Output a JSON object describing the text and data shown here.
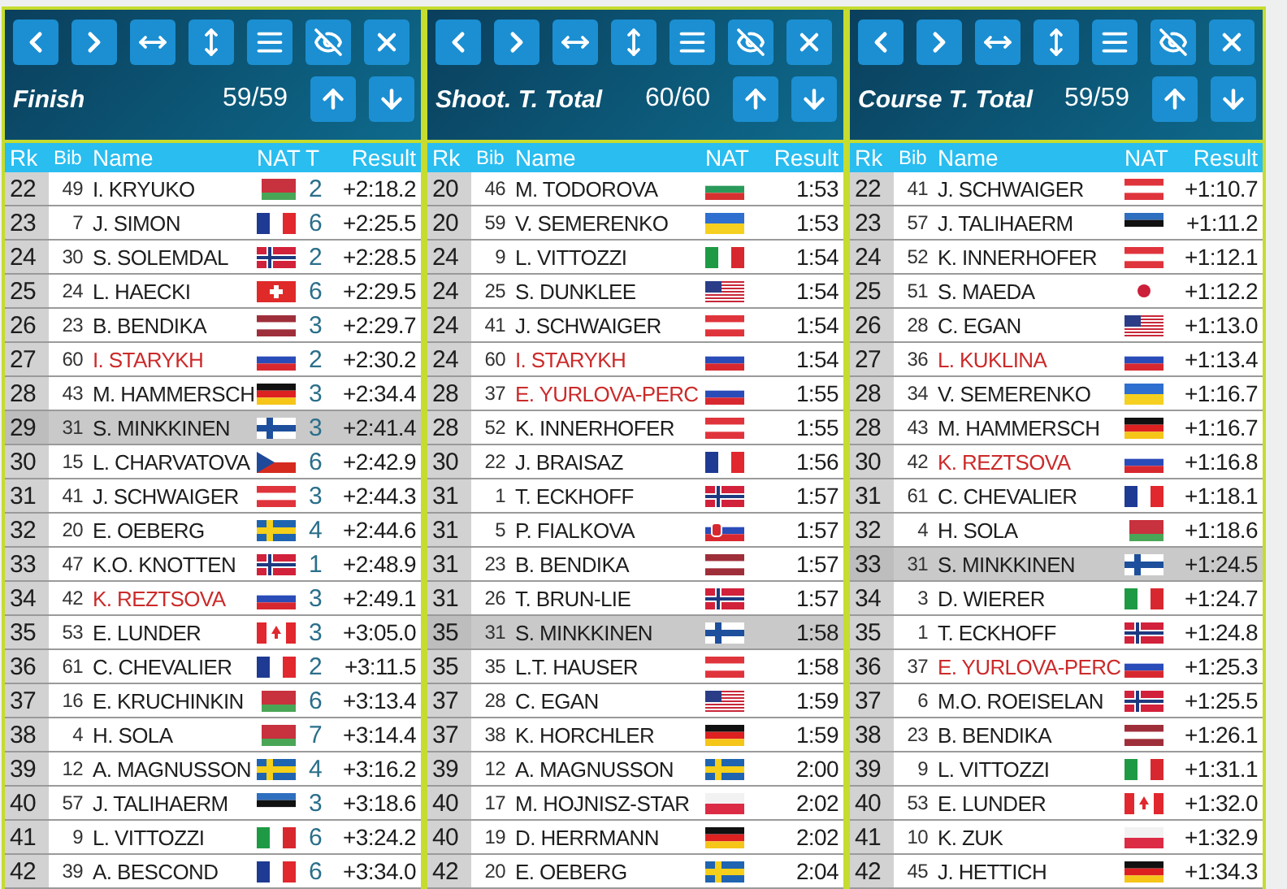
{
  "panels": [
    {
      "title": "Finish",
      "count": "59/59",
      "columns": [
        {
          "kind": "rank",
          "label": "Rk"
        },
        {
          "kind": "bib",
          "label": "Bib"
        },
        {
          "kind": "name",
          "label": "Name"
        },
        {
          "kind": "flag",
          "label": "NAT"
        },
        {
          "kind": "penalty",
          "label": "T"
        },
        {
          "kind": "result",
          "label": "Result"
        }
      ],
      "rows": [
        {
          "rank": "22",
          "bib": "49",
          "name": "I. KRYUKO",
          "flag": {
            "kind": "belarus"
          },
          "t": "2",
          "result": "+2:18.2",
          "flagged": false,
          "selected": false
        },
        {
          "rank": "23",
          "bib": "7",
          "name": "J. SIMON",
          "flag": {
            "kind": "france"
          },
          "t": "6",
          "result": "+2:25.5",
          "flagged": false,
          "selected": false
        },
        {
          "rank": "24",
          "bib": "30",
          "name": "S. SOLEMDAL",
          "flag": {
            "kind": "norway"
          },
          "t": "2",
          "result": "+2:28.5",
          "flagged": false,
          "selected": false
        },
        {
          "rank": "25",
          "bib": "24",
          "name": "L. HAECKI",
          "flag": {
            "kind": "switzerland"
          },
          "t": "6",
          "result": "+2:29.5",
          "flagged": false,
          "selected": false
        },
        {
          "rank": "26",
          "bib": "23",
          "name": "B. BENDIKA",
          "flag": {
            "kind": "latvia"
          },
          "t": "3",
          "result": "+2:29.7",
          "flagged": false,
          "selected": false
        },
        {
          "rank": "27",
          "bib": "60",
          "name": "I. STARYKH",
          "flag": {
            "kind": "russia"
          },
          "t": "2",
          "result": "+2:30.2",
          "flagged": true,
          "selected": false
        },
        {
          "rank": "28",
          "bib": "43",
          "name": "M. HAMMERSCH",
          "flag": {
            "kind": "germany"
          },
          "t": "3",
          "result": "+2:34.4",
          "flagged": false,
          "selected": false
        },
        {
          "rank": "29",
          "bib": "31",
          "name": "S. MINKKINEN",
          "flag": {
            "kind": "finland"
          },
          "t": "3",
          "result": "+2:41.4",
          "flagged": false,
          "selected": true
        },
        {
          "rank": "30",
          "bib": "15",
          "name": "L. CHARVATOVA",
          "flag": {
            "kind": "czechia"
          },
          "t": "6",
          "result": "+2:42.9",
          "flagged": false,
          "selected": false
        },
        {
          "rank": "31",
          "bib": "41",
          "name": "J. SCHWAIGER",
          "flag": {
            "kind": "austria"
          },
          "t": "3",
          "result": "+2:44.3",
          "flagged": false,
          "selected": false
        },
        {
          "rank": "32",
          "bib": "20",
          "name": "E. OEBERG",
          "flag": {
            "kind": "sweden"
          },
          "t": "4",
          "result": "+2:44.6",
          "flagged": false,
          "selected": false
        },
        {
          "rank": "33",
          "bib": "47",
          "name": "K.O. KNOTTEN",
          "flag": {
            "kind": "norway"
          },
          "t": "1",
          "result": "+2:48.9",
          "flagged": false,
          "selected": false
        },
        {
          "rank": "34",
          "bib": "42",
          "name": "K. REZTSOVA",
          "flag": {
            "kind": "russia"
          },
          "t": "3",
          "result": "+2:49.1",
          "flagged": true,
          "selected": false
        },
        {
          "rank": "35",
          "bib": "53",
          "name": "E. LUNDER",
          "flag": {
            "kind": "canada"
          },
          "t": "3",
          "result": "+3:05.0",
          "flagged": false,
          "selected": false
        },
        {
          "rank": "36",
          "bib": "61",
          "name": "C. CHEVALIER",
          "flag": {
            "kind": "france"
          },
          "t": "2",
          "result": "+3:11.5",
          "flagged": false,
          "selected": false
        },
        {
          "rank": "37",
          "bib": "16",
          "name": "E. KRUCHINKIN",
          "flag": {
            "kind": "belarus"
          },
          "t": "6",
          "result": "+3:13.4",
          "flagged": false,
          "selected": false
        },
        {
          "rank": "38",
          "bib": "4",
          "name": "H. SOLA",
          "flag": {
            "kind": "belarus"
          },
          "t": "7",
          "result": "+3:14.4",
          "flagged": false,
          "selected": false
        },
        {
          "rank": "39",
          "bib": "12",
          "name": "A. MAGNUSSON",
          "flag": {
            "kind": "sweden"
          },
          "t": "4",
          "result": "+3:16.2",
          "flagged": false,
          "selected": false
        },
        {
          "rank": "40",
          "bib": "57",
          "name": "J. TALIHAERM",
          "flag": {
            "kind": "estonia"
          },
          "t": "3",
          "result": "+3:18.6",
          "flagged": false,
          "selected": false
        },
        {
          "rank": "41",
          "bib": "9",
          "name": "L. VITTOZZI",
          "flag": {
            "kind": "italy"
          },
          "t": "6",
          "result": "+3:24.2",
          "flagged": false,
          "selected": false
        },
        {
          "rank": "42",
          "bib": "39",
          "name": "A. BESCOND",
          "flag": {
            "kind": "france"
          },
          "t": "6",
          "result": "+3:34.0",
          "flagged": false,
          "selected": false
        }
      ]
    },
    {
      "title": "Shoot. T. Total",
      "count": "60/60",
      "columns": [
        {
          "kind": "rank",
          "label": "Rk"
        },
        {
          "kind": "bib",
          "label": "Bib"
        },
        {
          "kind": "name",
          "label": "Name"
        },
        {
          "kind": "flag",
          "label": "NAT"
        },
        {
          "kind": "result",
          "label": "Result"
        }
      ],
      "rows": [
        {
          "rank": "20",
          "bib": "46",
          "name": "M. TODOROVA",
          "flag": {
            "kind": "bulgaria"
          },
          "result": "1:53",
          "flagged": false,
          "selected": false
        },
        {
          "rank": "20",
          "bib": "59",
          "name": "V. SEMERENKO",
          "flag": {
            "kind": "ukraine"
          },
          "result": "1:53",
          "flagged": false,
          "selected": false
        },
        {
          "rank": "24",
          "bib": "9",
          "name": "L. VITTOZZI",
          "flag": {
            "kind": "italy"
          },
          "result": "1:54",
          "flagged": false,
          "selected": false
        },
        {
          "rank": "24",
          "bib": "25",
          "name": "S. DUNKLEE",
          "flag": {
            "kind": "usa"
          },
          "result": "1:54",
          "flagged": false,
          "selected": false
        },
        {
          "rank": "24",
          "bib": "41",
          "name": "J. SCHWAIGER",
          "flag": {
            "kind": "austria"
          },
          "result": "1:54",
          "flagged": false,
          "selected": false
        },
        {
          "rank": "24",
          "bib": "60",
          "name": "I. STARYKH",
          "flag": {
            "kind": "russia"
          },
          "result": "1:54",
          "flagged": true,
          "selected": false
        },
        {
          "rank": "28",
          "bib": "37",
          "name": "E. YURLOVA-PERC",
          "flag": {
            "kind": "russia"
          },
          "result": "1:55",
          "flagged": true,
          "selected": false
        },
        {
          "rank": "28",
          "bib": "52",
          "name": "K. INNERHOFER",
          "flag": {
            "kind": "austria"
          },
          "result": "1:55",
          "flagged": false,
          "selected": false
        },
        {
          "rank": "30",
          "bib": "22",
          "name": "J. BRAISAZ",
          "flag": {
            "kind": "france"
          },
          "result": "1:56",
          "flagged": false,
          "selected": false
        },
        {
          "rank": "31",
          "bib": "1",
          "name": "T. ECKHOFF",
          "flag": {
            "kind": "norway"
          },
          "result": "1:57",
          "flagged": false,
          "selected": false
        },
        {
          "rank": "31",
          "bib": "5",
          "name": "P. FIALKOVA",
          "flag": {
            "kind": "slovakia"
          },
          "result": "1:57",
          "flagged": false,
          "selected": false
        },
        {
          "rank": "31",
          "bib": "23",
          "name": "B. BENDIKA",
          "flag": {
            "kind": "latvia"
          },
          "result": "1:57",
          "flagged": false,
          "selected": false
        },
        {
          "rank": "31",
          "bib": "26",
          "name": "T. BRUN-LIE",
          "flag": {
            "kind": "norway"
          },
          "result": "1:57",
          "flagged": false,
          "selected": false
        },
        {
          "rank": "35",
          "bib": "31",
          "name": "S. MINKKINEN",
          "flag": {
            "kind": "finland"
          },
          "result": "1:58",
          "flagged": false,
          "selected": true
        },
        {
          "rank": "35",
          "bib": "35",
          "name": "L.T. HAUSER",
          "flag": {
            "kind": "austria"
          },
          "result": "1:58",
          "flagged": false,
          "selected": false
        },
        {
          "rank": "37",
          "bib": "28",
          "name": "C. EGAN",
          "flag": {
            "kind": "usa"
          },
          "result": "1:59",
          "flagged": false,
          "selected": false
        },
        {
          "rank": "37",
          "bib": "38",
          "name": "K. HORCHLER",
          "flag": {
            "kind": "germany"
          },
          "result": "1:59",
          "flagged": false,
          "selected": false
        },
        {
          "rank": "39",
          "bib": "12",
          "name": "A. MAGNUSSON",
          "flag": {
            "kind": "sweden"
          },
          "result": "2:00",
          "flagged": false,
          "selected": false
        },
        {
          "rank": "40",
          "bib": "17",
          "name": "M. HOJNISZ-STAR",
          "flag": {
            "kind": "poland"
          },
          "result": "2:02",
          "flagged": false,
          "selected": false
        },
        {
          "rank": "40",
          "bib": "19",
          "name": "D. HERRMANN",
          "flag": {
            "kind": "germany"
          },
          "result": "2:02",
          "flagged": false,
          "selected": false
        },
        {
          "rank": "42",
          "bib": "20",
          "name": "E. OEBERG",
          "flag": {
            "kind": "sweden"
          },
          "result": "2:04",
          "flagged": false,
          "selected": false
        }
      ]
    },
    {
      "title": "Course T. Total",
      "count": "59/59",
      "columns": [
        {
          "kind": "rank",
          "label": "Rk"
        },
        {
          "kind": "bib",
          "label": "Bib"
        },
        {
          "kind": "name",
          "label": "Name"
        },
        {
          "kind": "flag",
          "label": "NAT"
        },
        {
          "kind": "result",
          "label": "Result"
        }
      ],
      "rows": [
        {
          "rank": "22",
          "bib": "41",
          "name": "J. SCHWAIGER",
          "flag": {
            "kind": "austria"
          },
          "result": "+1:10.7",
          "flagged": false,
          "selected": false
        },
        {
          "rank": "23",
          "bib": "57",
          "name": "J. TALIHAERM",
          "flag": {
            "kind": "estonia"
          },
          "result": "+1:11.2",
          "flagged": false,
          "selected": false
        },
        {
          "rank": "24",
          "bib": "52",
          "name": "K. INNERHOFER",
          "flag": {
            "kind": "austria"
          },
          "result": "+1:12.1",
          "flagged": false,
          "selected": false
        },
        {
          "rank": "25",
          "bib": "51",
          "name": "S. MAEDA",
          "flag": {
            "kind": "japan"
          },
          "result": "+1:12.2",
          "flagged": false,
          "selected": false
        },
        {
          "rank": "26",
          "bib": "28",
          "name": "C. EGAN",
          "flag": {
            "kind": "usa"
          },
          "result": "+1:13.0",
          "flagged": false,
          "selected": false
        },
        {
          "rank": "27",
          "bib": "36",
          "name": "L. KUKLINA",
          "flag": {
            "kind": "russia"
          },
          "result": "+1:13.4",
          "flagged": true,
          "selected": false
        },
        {
          "rank": "28",
          "bib": "34",
          "name": "V. SEMERENKO",
          "flag": {
            "kind": "ukraine"
          },
          "result": "+1:16.7",
          "flagged": false,
          "selected": false
        },
        {
          "rank": "28",
          "bib": "43",
          "name": "M. HAMMERSCH",
          "flag": {
            "kind": "germany"
          },
          "result": "+1:16.7",
          "flagged": false,
          "selected": false
        },
        {
          "rank": "30",
          "bib": "42",
          "name": "K. REZTSOVA",
          "flag": {
            "kind": "russia"
          },
          "result": "+1:16.8",
          "flagged": true,
          "selected": false
        },
        {
          "rank": "31",
          "bib": "61",
          "name": "C. CHEVALIER",
          "flag": {
            "kind": "france"
          },
          "result": "+1:18.1",
          "flagged": false,
          "selected": false
        },
        {
          "rank": "32",
          "bib": "4",
          "name": "H. SOLA",
          "flag": {
            "kind": "belarus"
          },
          "result": "+1:18.6",
          "flagged": false,
          "selected": false
        },
        {
          "rank": "33",
          "bib": "31",
          "name": "S. MINKKINEN",
          "flag": {
            "kind": "finland"
          },
          "result": "+1:24.5",
          "flagged": false,
          "selected": true
        },
        {
          "rank": "34",
          "bib": "3",
          "name": "D. WIERER",
          "flag": {
            "kind": "italy"
          },
          "result": "+1:24.7",
          "flagged": false,
          "selected": false
        },
        {
          "rank": "35",
          "bib": "1",
          "name": "T. ECKHOFF",
          "flag": {
            "kind": "norway"
          },
          "result": "+1:24.8",
          "flagged": false,
          "selected": false
        },
        {
          "rank": "36",
          "bib": "37",
          "name": "E. YURLOVA-PERC",
          "flag": {
            "kind": "russia"
          },
          "result": "+1:25.3",
          "flagged": true,
          "selected": false
        },
        {
          "rank": "37",
          "bib": "6",
          "name": "M.O. ROEISELAN",
          "flag": {
            "kind": "norway"
          },
          "result": "+1:25.5",
          "flagged": false,
          "selected": false
        },
        {
          "rank": "38",
          "bib": "23",
          "name": "B. BENDIKA",
          "flag": {
            "kind": "latvia"
          },
          "result": "+1:26.1",
          "flagged": false,
          "selected": false
        },
        {
          "rank": "39",
          "bib": "9",
          "name": "L. VITTOZZI",
          "flag": {
            "kind": "italy"
          },
          "result": "+1:31.1",
          "flagged": false,
          "selected": false
        },
        {
          "rank": "40",
          "bib": "53",
          "name": "E. LUNDER",
          "flag": {
            "kind": "canada"
          },
          "result": "+1:32.0",
          "flagged": false,
          "selected": false
        },
        {
          "rank": "41",
          "bib": "10",
          "name": "K. ZUK",
          "flag": {
            "kind": "poland"
          },
          "result": "+1:32.9",
          "flagged": false,
          "selected": false
        },
        {
          "rank": "42",
          "bib": "45",
          "name": "J. HETTICH",
          "flag": {
            "kind": "germany"
          },
          "result": "+1:34.3",
          "flagged": false,
          "selected": false
        }
      ]
    }
  ]
}
